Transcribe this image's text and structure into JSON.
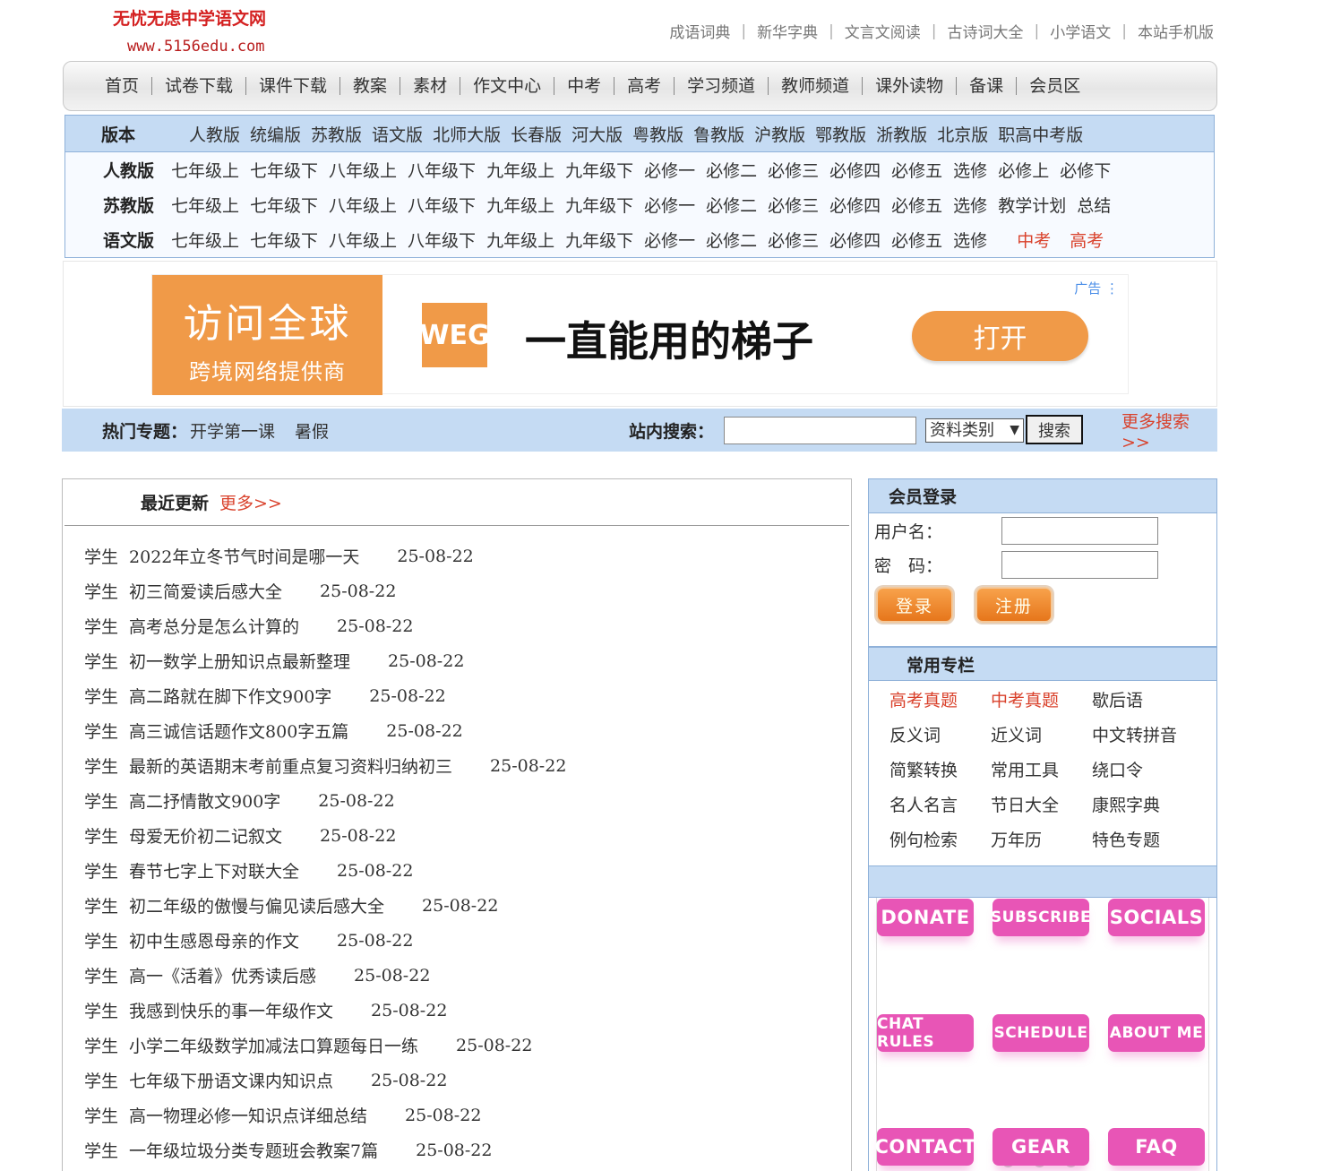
{
  "logo": {
    "name": "无忧无虑中学语文网",
    "url": "www.5156edu.com"
  },
  "toplinks": [
    "成语词典",
    "新华字典",
    "文言文阅读",
    "古诗词大全",
    "小学语文",
    "本站手机版"
  ],
  "mainnav": [
    "首页",
    "试卷下载",
    "课件下载",
    "教案",
    "素材",
    "作文中心",
    "中考",
    "高考",
    "学习频道",
    "教师频道",
    "课外读物",
    "备课",
    "会员区"
  ],
  "versions": {
    "label": "版本",
    "editions": [
      "人教版",
      "统编版",
      "苏教版",
      "语文版",
      "北师大版",
      "长春版",
      "河大版",
      "粤教版",
      "鲁教版",
      "沪教版",
      "鄂教版",
      "浙教版",
      "北京版",
      "职高中考版"
    ],
    "rows": [
      {
        "label": "人教版",
        "grades": [
          "七年级上",
          "七年级下",
          "八年级上",
          "八年级下",
          "九年级上",
          "九年级下",
          "必修一",
          "必修二",
          "必修三",
          "必修四",
          "必修五",
          "选修",
          "必修上",
          "必修下"
        ],
        "extra": []
      },
      {
        "label": "苏教版",
        "grades": [
          "七年级上",
          "七年级下",
          "八年级上",
          "八年级下",
          "九年级上",
          "九年级下",
          "必修一",
          "必修二",
          "必修三",
          "必修四",
          "必修五",
          "选修",
          "教学计划",
          "总结"
        ],
        "extra": []
      },
      {
        "label": "语文版",
        "grades": [
          "七年级上",
          "七年级下",
          "八年级上",
          "八年级下",
          "九年级上",
          "九年级下",
          "必修一",
          "必修二",
          "必修三",
          "必修四",
          "必修五",
          "选修"
        ],
        "extra": [
          "中考",
          "高考"
        ]
      }
    ]
  },
  "ad": {
    "left_big": "访问全球",
    "left_small": "跨境网络提供商",
    "brand": "WEG",
    "slogan": "一直能用的梯子",
    "button": "打开",
    "tag": "广告 ⋮"
  },
  "hotbar": {
    "label": "热门专题：",
    "items": [
      "开学第一课",
      "暑假"
    ],
    "search_label": "站内搜索：",
    "select_value": "资料类别",
    "search_button": "搜索",
    "more": "更多搜索>>"
  },
  "recent": {
    "title": "最近更新",
    "more": "更多>>",
    "items": [
      {
        "cat": "学生",
        "title": "2022年立冬节气时间是哪一天",
        "date": "25-08-22"
      },
      {
        "cat": "学生",
        "title": "初三简爱读后感大全",
        "date": "25-08-22"
      },
      {
        "cat": "学生",
        "title": "高考总分是怎么计算的",
        "date": "25-08-22"
      },
      {
        "cat": "学生",
        "title": "初一数学上册知识点最新整理",
        "date": "25-08-22"
      },
      {
        "cat": "学生",
        "title": "高二路就在脚下作文900字",
        "date": "25-08-22"
      },
      {
        "cat": "学生",
        "title": "高三诚信话题作文800字五篇",
        "date": "25-08-22"
      },
      {
        "cat": "学生",
        "title": "最新的英语期末考前重点复习资料归纳初三",
        "date": "25-08-22"
      },
      {
        "cat": "学生",
        "title": "高二抒情散文900字",
        "date": "25-08-22"
      },
      {
        "cat": "学生",
        "title": "母爱无价初二记叙文",
        "date": "25-08-22"
      },
      {
        "cat": "学生",
        "title": "春节七字上下对联大全",
        "date": "25-08-22"
      },
      {
        "cat": "学生",
        "title": "初二年级的傲慢与偏见读后感大全",
        "date": "25-08-22"
      },
      {
        "cat": "学生",
        "title": "初中生感恩母亲的作文",
        "date": "25-08-22"
      },
      {
        "cat": "学生",
        "title": "高一《活着》优秀读后感",
        "date": "25-08-22"
      },
      {
        "cat": "学生",
        "title": "我感到快乐的事一年级作文",
        "date": "25-08-22"
      },
      {
        "cat": "学生",
        "title": "小学二年级数学加减法口算题每日一练",
        "date": "25-08-22"
      },
      {
        "cat": "学生",
        "title": "七年级下册语文课内知识点",
        "date": "25-08-22"
      },
      {
        "cat": "学生",
        "title": "高一物理必修一知识点详细总结",
        "date": "25-08-22"
      },
      {
        "cat": "学生",
        "title": "一年级垃圾分类专题班会教案7篇",
        "date": "25-08-22"
      }
    ]
  },
  "login": {
    "title": "会员登录",
    "user_label": "用户名：",
    "pass_label": "密　码：",
    "login_button": "登录",
    "register_button": "注册"
  },
  "columns": {
    "title": "常用专栏",
    "items": [
      {
        "label": "高考真题",
        "red": true
      },
      {
        "label": "中考真题",
        "red": true
      },
      {
        "label": "歇后语",
        "red": false
      },
      {
        "label": "反义词",
        "red": false
      },
      {
        "label": "近义词",
        "red": false
      },
      {
        "label": "中文转拼音",
        "red": false
      },
      {
        "label": "简繁转换",
        "red": false
      },
      {
        "label": "常用工具",
        "red": false
      },
      {
        "label": "绕口令",
        "red": false
      },
      {
        "label": "名人名言",
        "red": false
      },
      {
        "label": "节日大全",
        "red": false
      },
      {
        "label": "康熙字典",
        "red": false
      },
      {
        "label": "例句检索",
        "red": false
      },
      {
        "label": "万年历",
        "red": false
      },
      {
        "label": "特色专题",
        "red": false
      }
    ]
  },
  "pink_buttons": [
    "DONATE",
    "SUBSCRIBE",
    "SOCIALS",
    "CHAT RULES",
    "SCHEDULE",
    "ABOUT ME",
    "CONTACT",
    "GEAR",
    "FAQ"
  ],
  "colors": {
    "accent_red": "#d9412b",
    "panel_blue": "#c5dbf3",
    "ad_orange": "#f09a48",
    "pink": "#e855b6"
  }
}
